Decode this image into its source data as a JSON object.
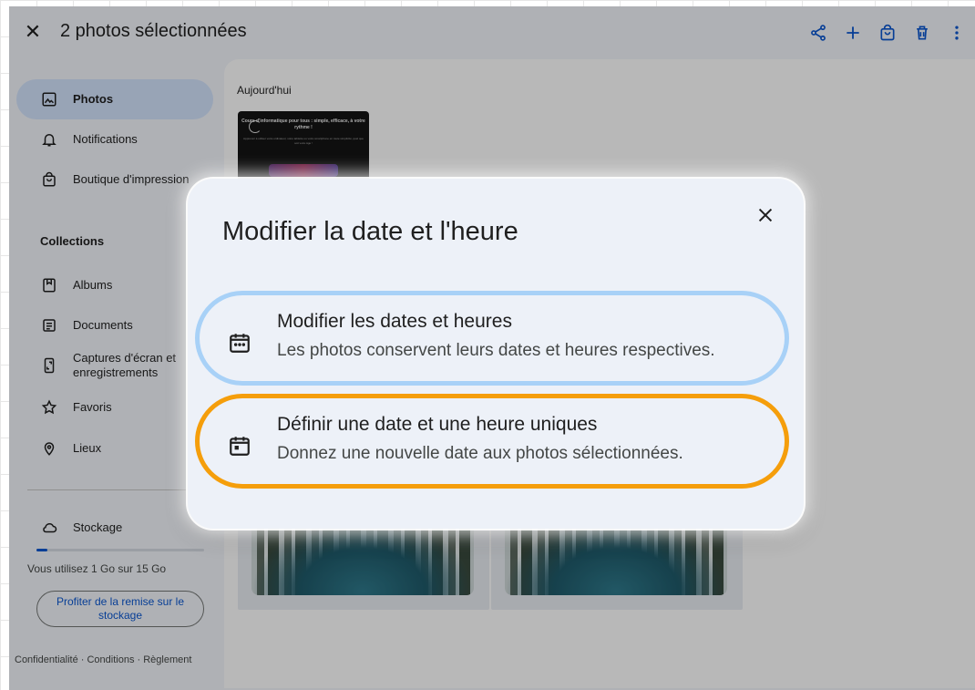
{
  "header": {
    "close_icon": "close-icon",
    "title": "2 photos sélectionnées",
    "actions": [
      "share-icon",
      "add-icon",
      "shopping-bag-icon",
      "trash-icon",
      "more-vert-icon"
    ]
  },
  "sidebar": {
    "items": [
      {
        "label": "Photos",
        "icon": "photo-icon",
        "active": true
      },
      {
        "label": "Notifications",
        "icon": "bell-icon"
      },
      {
        "label": "Boutique d'impression",
        "icon": "shopping-bag-icon"
      }
    ],
    "collections_heading": "Collections",
    "collections": [
      {
        "label": "Albums",
        "icon": "album-icon"
      },
      {
        "label": "Documents",
        "icon": "document-icon"
      },
      {
        "label": "Captures d'écran et enregistrements",
        "icon": "screenshot-icon"
      },
      {
        "label": "Favoris",
        "icon": "star-icon"
      },
      {
        "label": "Lieux",
        "icon": "location-icon"
      }
    ],
    "storage": {
      "label": "Stockage",
      "icon": "cloud-icon",
      "used_fraction": 0.067,
      "usage_text": "Vous utilisez 1 Go sur 15 Go",
      "offer_button": "Profiter de la remise sur le stockage"
    },
    "footer": "Confidentialité · Conditions · Règlement"
  },
  "main": {
    "day_label": "Aujourd'hui",
    "thumbnail": {
      "title": "Cours d'informatique pour tous : simple, efficace, à votre rythme !",
      "subtitle": "Apprenez à utiliser votre ordinateur, votre tablette ou votre smartphone en toute simplicité, quel que soit votre âge !"
    }
  },
  "dialog": {
    "title": "Modifier la date et l'heure",
    "options": [
      {
        "title": "Modifier les dates et heures",
        "description": "Les photos conservent leurs dates et heures respectives.",
        "icon": "calendar-icon",
        "highlight_color": "#a8d1f7"
      },
      {
        "title": "Définir une date et une heure uniques",
        "description": "Donnez une nouvelle date aux photos sélectionnées.",
        "icon": "calendar-event-icon",
        "highlight_color": "#f59e0b"
      }
    ]
  },
  "colors": {
    "accent": "#0b57d0",
    "active_nav": "#d3e3fd",
    "dialog_bg": "#edf1f8"
  }
}
